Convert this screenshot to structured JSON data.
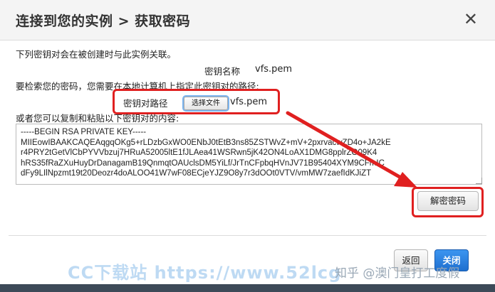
{
  "dialog": {
    "title": "连接到您的实例 > 获取密码",
    "close_symbol": "✕",
    "intro_text": "下列密钥对会在被创建时与此实例关联。",
    "key_name_label": "密钥名称",
    "key_name_value": "vfs.pem",
    "retrieve_text": "要检索您的密码，您需要在本地计算机上指定此密钥对的路径:",
    "key_path_label": "密钥对路径",
    "choose_file_label": "选择文件",
    "chosen_file": "vfs.pem",
    "paste_text": "或者您可以复制和粘贴以下密钥对的内容:",
    "key_content": "-----BEGIN RSA PRIVATE KEY-----\nMIIEowIBAAKCAQEAqgqOKg5+rLDzbGxWO0ENbJ0tEtB3ns85ZSTWvZ+mV+2pxrvacwZD4o+JA2kE\nr4PRY2tGetVlCbPYVVbzuj7HRuA52005ltE1fJLAea41WSRwn5jK42ON4LoAX1DMG8pplrZO09K4\nhRS35fRaZXuHuyDrDanagamB19QnmqtOAUclsDM5YiLf/JrTnCFpbqHVnJV71B95404XYM9CFmIC\ndFy9LIlNpzmt19t20Deozr4doALOO41W7wF08ECjeYJZ9O8y7r3dOOt0VTV/vmMW7zaefIdKJiZT",
    "decrypt_button": "解密密码",
    "back_button": "返回",
    "close_button": "关闭"
  },
  "watermark": {
    "text": "CC下载站 https://www.52lcg",
    "text2": "知乎 @澳门皇打工度假"
  },
  "colors": {
    "highlight": "#e02020",
    "primary_button": "#2a80e0",
    "header_bg": "#f4f4f4"
  }
}
